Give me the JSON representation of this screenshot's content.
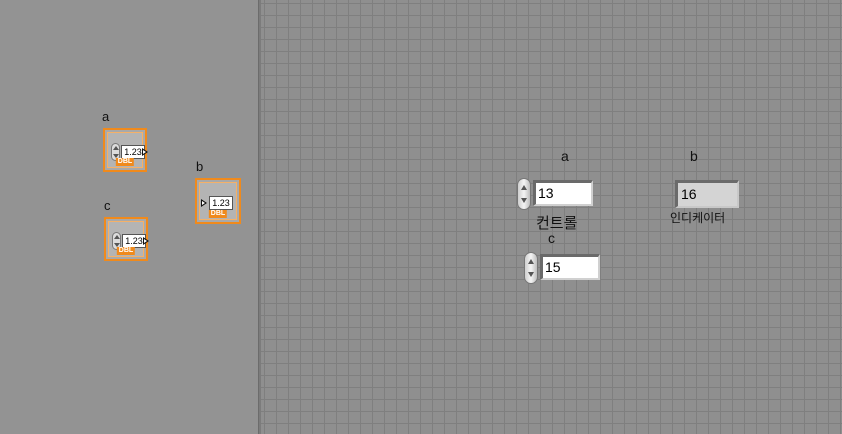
{
  "block_diagram": {
    "terminals": [
      {
        "id": "a",
        "label": "a",
        "value_display": "1.23",
        "datatype": "DBL",
        "kind": "control"
      },
      {
        "id": "c",
        "label": "c",
        "value_display": "1.23",
        "datatype": "DBL",
        "kind": "control"
      },
      {
        "id": "b",
        "label": "b",
        "value_display": "1.23",
        "datatype": "DBL",
        "kind": "indicator"
      }
    ],
    "accent_color": "#f08a1c"
  },
  "front_panel": {
    "control_a": {
      "label": "a",
      "value": "13",
      "caption": "컨트롤"
    },
    "control_c": {
      "label": "c",
      "value": "15"
    },
    "indicator_b": {
      "label": "b",
      "value": "16",
      "caption": "인디케이터"
    },
    "grid_color": "#7f7f7f",
    "background_color": "#8f8f8f"
  }
}
